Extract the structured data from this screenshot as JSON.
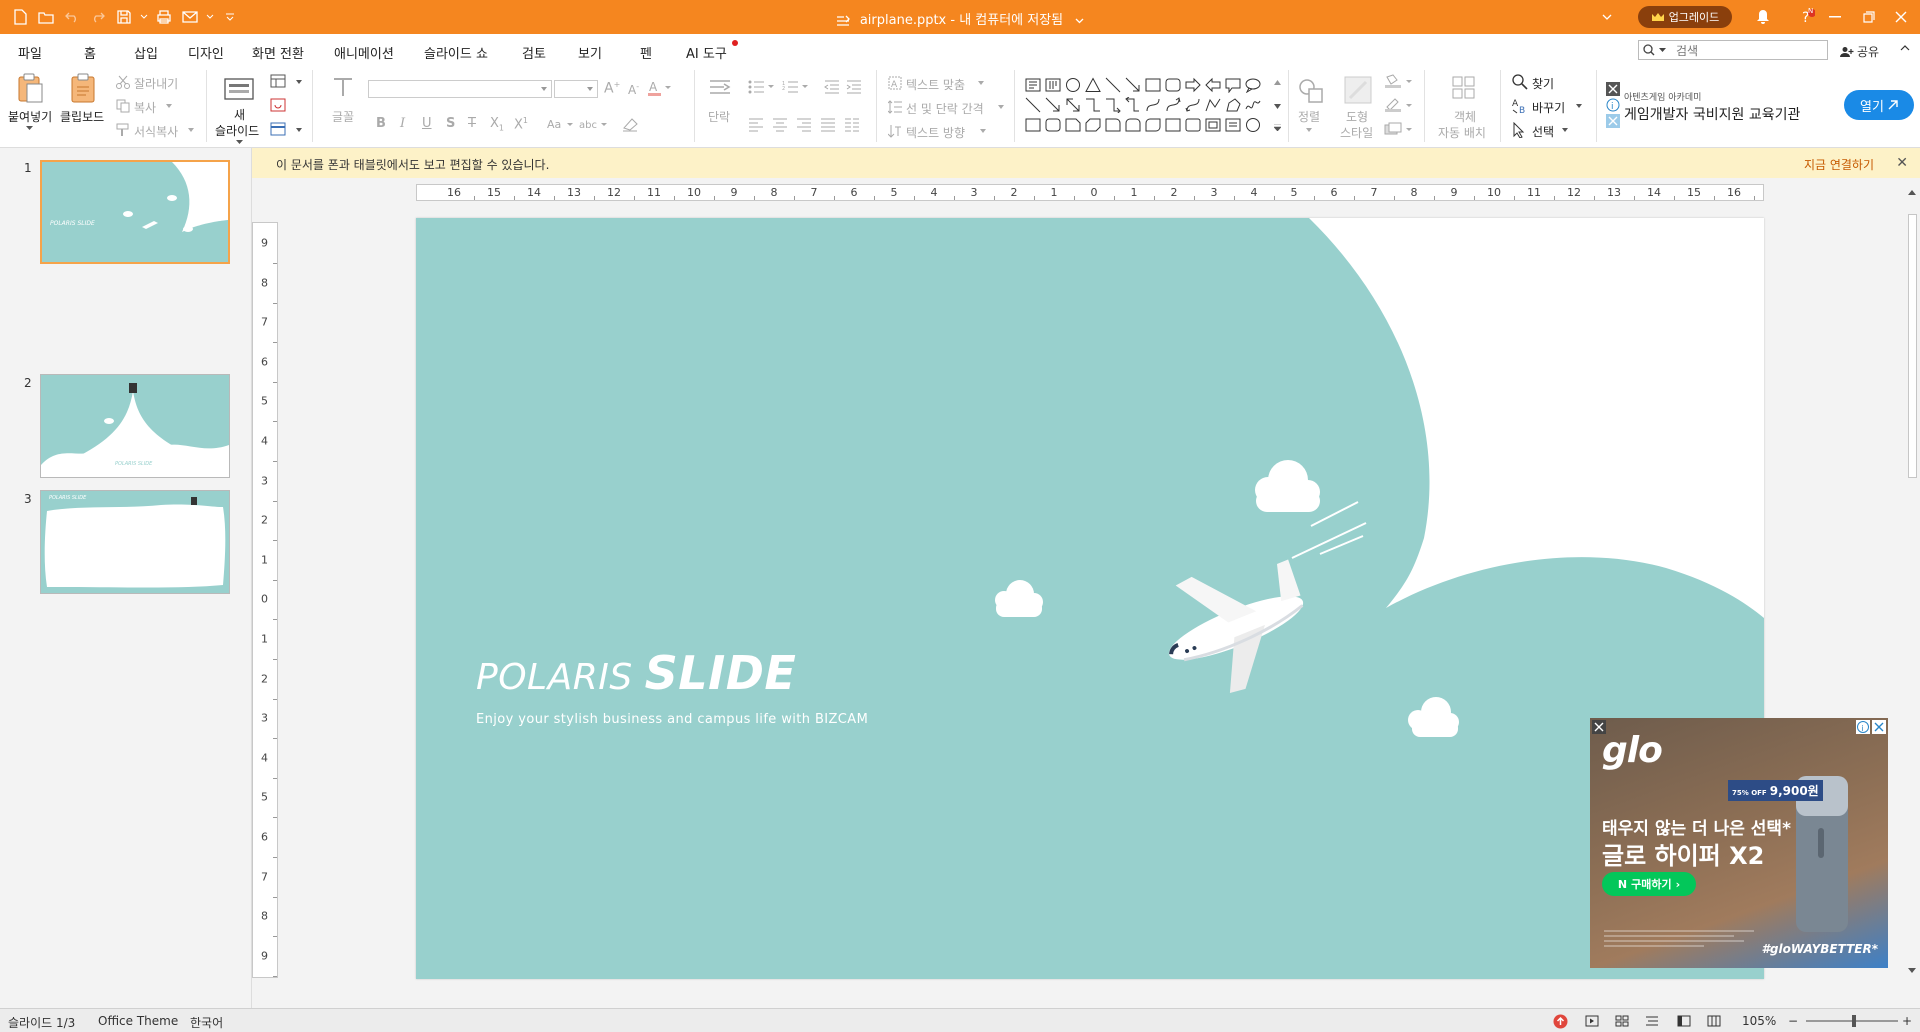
{
  "window": {
    "title": "airplane.pptx - 내 컴퓨터에 저장됨",
    "upgrade_label": "업그레이드",
    "notification_badge": "N"
  },
  "menu": {
    "tabs": [
      "파일",
      "홈",
      "삽입",
      "디자인",
      "화면 전환",
      "애니메이션",
      "슬라이드 쇼",
      "검토",
      "보기",
      "펜",
      "AI 도구"
    ],
    "active_tab": "홈",
    "search_placeholder": "검색",
    "share_label": "공유"
  },
  "ribbon": {
    "paste": "붙여넣기",
    "clipboard": "클립보드",
    "cut": "잘라내기",
    "copy": "복사",
    "format_painter": "서식복사",
    "new_slide_line1": "새",
    "new_slide_line2": "슬라이드",
    "font": "글꼴",
    "paragraph": "단락",
    "text_fit": "텍스트 맞춤",
    "line_spacing": "선 및 단락 간격",
    "text_direction": "텍스트 방향",
    "arrange": "정렬",
    "shape_style_line1": "도형",
    "shape_style_line2": "스타일",
    "auto_layout_line1": "객체",
    "auto_layout_line2": "자동 배치",
    "find": "찾기",
    "replace": "바꾸기",
    "select": "선택",
    "bold": "B",
    "italic": "I",
    "underline": "U",
    "strike": "S"
  },
  "ribbon_ad": {
    "small": "아텐츠게임 아카데미",
    "main": "게임개발자 국비지원 교육기관",
    "open_label": "열기"
  },
  "notice": {
    "text": "이 문서를 폰과 태블릿에서도 보고 편집할 수 있습니다.",
    "link": "지금 연결하기"
  },
  "slides": {
    "numbers": [
      "1",
      "2",
      "3"
    ],
    "thumb_text": "POLARIS SLIDE",
    "selected_index": 0
  },
  "ruler": {
    "h_marks": [
      "16",
      "15",
      "14",
      "13",
      "12",
      "11",
      "10",
      "9",
      "8",
      "7",
      "6",
      "5",
      "4",
      "3",
      "2",
      "1",
      "0",
      "1",
      "2",
      "3",
      "4",
      "5",
      "6",
      "7",
      "8",
      "9",
      "10",
      "11",
      "12",
      "13",
      "14",
      "15",
      "16"
    ],
    "v_marks": [
      "9",
      "8",
      "7",
      "6",
      "5",
      "4",
      "3",
      "2",
      "1",
      "0",
      "1",
      "2",
      "3",
      "4",
      "5",
      "6",
      "7",
      "8",
      "9"
    ]
  },
  "slide": {
    "title_part1": "POLARIS ",
    "title_part2": "SLIDE",
    "subtitle": "Enjoy your stylish business and campus life with BIZCAM",
    "bg_color": "#98d0cd"
  },
  "ad": {
    "logo": "glo",
    "price": "9,900원",
    "discount": "75% OFF",
    "line1": "태우지 않는 더 나은 선택*",
    "line2": "글로 하이퍼 X2",
    "buy_label": "구매하기",
    "hashtag": "#gloWAYBETTER*"
  },
  "status": {
    "slide_pos": "슬라이드 1/3",
    "theme": "Office Theme",
    "language": "한국어",
    "zoom": "105%"
  },
  "colors": {
    "accent": "#f5861f",
    "slide_teal": "#98d0cd"
  }
}
